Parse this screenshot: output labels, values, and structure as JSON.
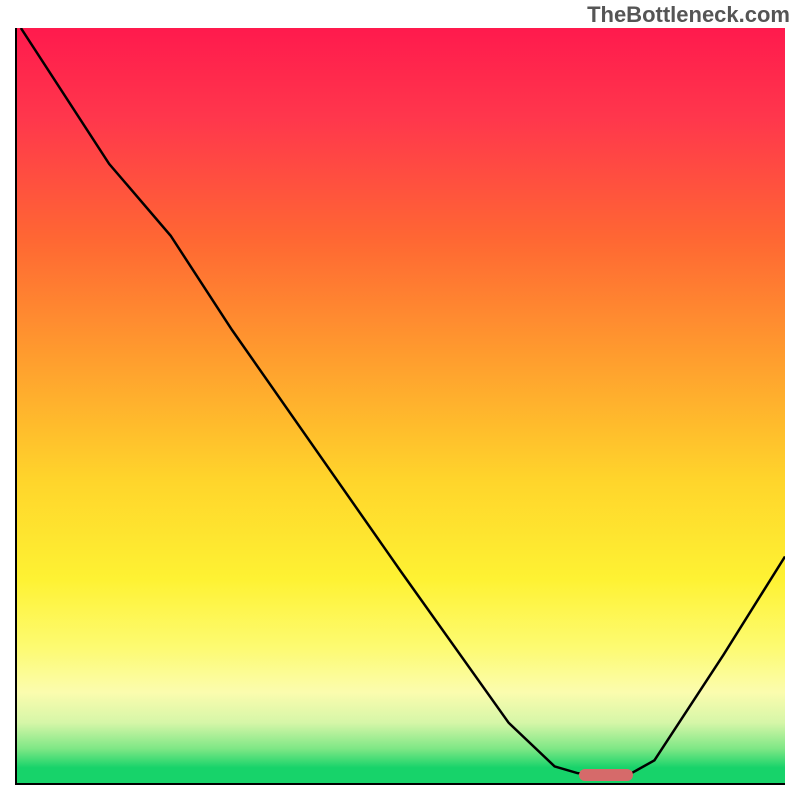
{
  "watermark": "TheBottleneck.com",
  "chart_data": {
    "type": "line",
    "title": "",
    "xlabel": "",
    "ylabel": "",
    "x_range": [
      0,
      100
    ],
    "y_range": [
      0,
      100
    ],
    "curve_points": [
      {
        "x": 0.5,
        "y": 100
      },
      {
        "x": 12,
        "y": 82
      },
      {
        "x": 20,
        "y": 72.5
      },
      {
        "x": 28,
        "y": 60
      },
      {
        "x": 50,
        "y": 28
      },
      {
        "x": 64,
        "y": 8
      },
      {
        "x": 70,
        "y": 2.2
      },
      {
        "x": 73,
        "y": 1.3
      },
      {
        "x": 80,
        "y": 1.3
      },
      {
        "x": 83,
        "y": 3
      },
      {
        "x": 92,
        "y": 17
      },
      {
        "x": 100,
        "y": 30
      }
    ],
    "marker": {
      "x_start": 73,
      "x_end": 80,
      "y": 1.3,
      "color": "#d66a6a"
    },
    "background_gradient": [
      {
        "stop": 0,
        "color": "#ff1a4d"
      },
      {
        "stop": 100,
        "color": "#17d36a"
      }
    ]
  }
}
